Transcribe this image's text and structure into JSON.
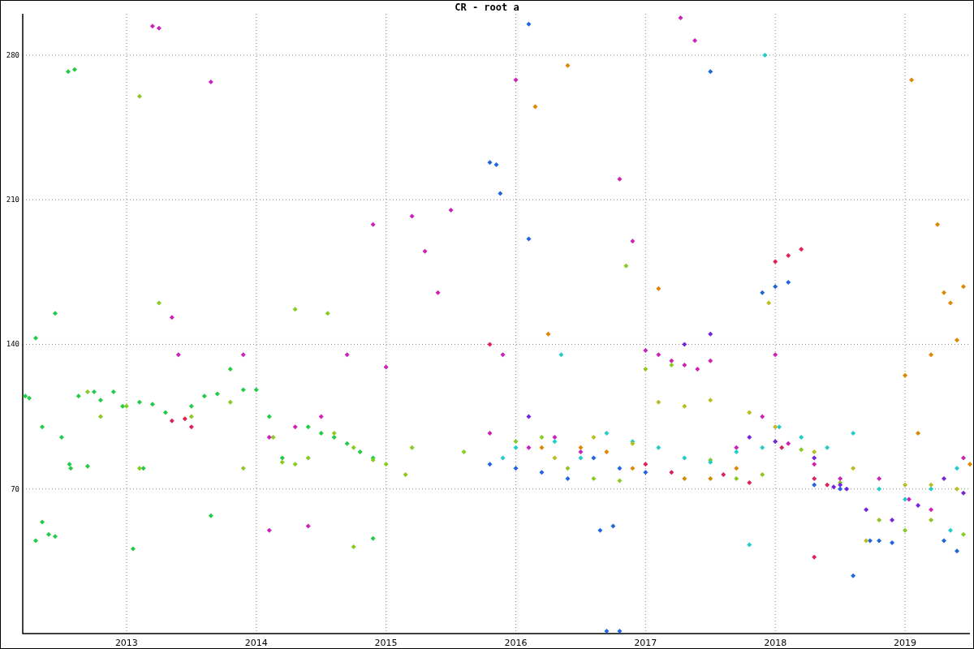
{
  "chart_data": {
    "type": "scatter",
    "title": "CR - root a",
    "grid": true,
    "xlim": [
      2012.2,
      2019.5
    ],
    "ylim": [
      0,
      300
    ],
    "xticks": [
      {
        "value": 2013,
        "label": "2013"
      },
      {
        "value": 2014,
        "label": "2014"
      },
      {
        "value": 2015,
        "label": "2015"
      },
      {
        "value": 2016,
        "label": "2016"
      },
      {
        "value": 2017,
        "label": "2017"
      },
      {
        "value": 2018,
        "label": "2018"
      },
      {
        "value": 2019,
        "label": "2019"
      }
    ],
    "yticks": [
      {
        "value": 70,
        "label": "70"
      },
      {
        "value": 140,
        "label": "140"
      },
      {
        "value": 210,
        "label": "210"
      },
      {
        "value": 280,
        "label": "280"
      }
    ],
    "series": [
      {
        "color": "#22cc44",
        "x": [
          2012.22,
          2012.25,
          2012.3,
          2012.35,
          2012.45,
          2012.5,
          2012.4,
          2012.45,
          2012.55,
          2012.6,
          2012.63,
          2012.75,
          2012.8,
          2012.9,
          2012.97,
          2013.13,
          2013.1,
          2013.2,
          2013.3,
          2013.5,
          2013.6,
          2013.65,
          2013.7,
          2013.8,
          2013.9,
          2014.0,
          2014.1,
          2014.2,
          2014.4,
          2014.5,
          2014.6,
          2014.7,
          2014.8,
          2014.9,
          2013.05,
          2012.56,
          2012.57,
          2012.7,
          2014.9,
          2012.3,
          2012.35
        ],
        "values": [
          115,
          114,
          143,
          100,
          155,
          95,
          48,
          47,
          272,
          273,
          115,
          117,
          113,
          117,
          110,
          80,
          112,
          111,
          107,
          110,
          115,
          57,
          116,
          128,
          118,
          118,
          105,
          85,
          100,
          97,
          95,
          92,
          88,
          85,
          41,
          82,
          80,
          81,
          46,
          45,
          54
        ]
      },
      {
        "color": "#88cc22",
        "x": [
          2012.7,
          2012.8,
          2013.0,
          2013.1,
          2013.25,
          2013.5,
          2013.8,
          2013.9,
          2014.13,
          2014.2,
          2014.3,
          2014.4,
          2014.6,
          2014.75,
          2014.9,
          2015.0,
          2015.15,
          2014.3,
          2014.55,
          2015.6,
          2016.0,
          2016.2,
          2016.4,
          2016.6,
          2016.8,
          2017.0,
          2017.2,
          2017.5,
          2017.7,
          2017.9,
          2018.2,
          2018.5,
          2018.8,
          2019.0,
          2019.2,
          2019.45,
          2016.85,
          2013.1,
          2014.75,
          2015.2
        ],
        "values": [
          117,
          105,
          110,
          260,
          160,
          105,
          112,
          80,
          95,
          83,
          82,
          85,
          97,
          90,
          84,
          82,
          77,
          157,
          155,
          88,
          93,
          95,
          80,
          75,
          74,
          128,
          130,
          84,
          75,
          77,
          89,
          73,
          55,
          50,
          55,
          48,
          178,
          80,
          42,
          90
        ]
      },
      {
        "color": "#cc22bb",
        "x": [
          2013.2,
          2013.25,
          2013.35,
          2013.4,
          2013.65,
          2013.9,
          2014.1,
          2014.3,
          2014.5,
          2014.7,
          2014.9,
          2015.0,
          2015.2,
          2015.3,
          2015.4,
          2015.5,
          2016.0,
          2016.1,
          2016.3,
          2016.5,
          2016.8,
          2016.9,
          2017.0,
          2017.1,
          2017.2,
          2017.3,
          2017.4,
          2017.5,
          2017.7,
          2017.9,
          2018.0,
          2018.1,
          2018.3,
          2018.5,
          2018.8,
          2019.03,
          2019.2,
          2019.45,
          2017.27,
          2017.38,
          2015.8,
          2015.9,
          2014.1,
          2014.4
        ],
        "values": [
          294,
          293,
          153,
          135,
          267,
          135,
          95,
          100,
          105,
          135,
          198,
          129,
          202,
          185,
          165,
          205,
          268,
          90,
          95,
          88,
          220,
          190,
          137,
          135,
          132,
          130,
          128,
          132,
          90,
          105,
          135,
          92,
          82,
          75,
          75,
          65,
          60,
          85,
          298,
          287,
          97,
          135,
          50,
          52
        ]
      },
      {
        "color": "#dd2255",
        "x": [
          2013.35,
          2013.45,
          2013.5,
          2015.8,
          2017.0,
          2017.2,
          2017.6,
          2017.8,
          2018.0,
          2018.1,
          2018.2,
          2018.3,
          2018.4,
          2018.05,
          2018.3
        ],
        "values": [
          103,
          104,
          100,
          140,
          82,
          78,
          77,
          73,
          180,
          183,
          186,
          75,
          72,
          90,
          37
        ]
      },
      {
        "color": "#2266dd",
        "x": [
          2015.8,
          2015.85,
          2015.88,
          2016.1,
          2016.1,
          2015.8,
          2016.0,
          2016.2,
          2016.4,
          2016.6,
          2016.8,
          2017.0,
          2016.7,
          2016.8,
          2017.5,
          2017.9,
          2018.0,
          2018.1,
          2018.3,
          2018.5,
          2018.6,
          2018.73,
          2018.8,
          2018.9,
          2019.3,
          2019.4,
          2016.65,
          2016.75
        ],
        "values": [
          228,
          227,
          213,
          191,
          295,
          82,
          80,
          78,
          75,
          85,
          80,
          78,
          0,
          0,
          272,
          165,
          168,
          170,
          72,
          70,
          28,
          45,
          45,
          44,
          45,
          40,
          50,
          52
        ]
      },
      {
        "color": "#22cccc",
        "x": [
          2015.9,
          2016.0,
          2016.3,
          2016.5,
          2016.7,
          2016.9,
          2017.1,
          2017.3,
          2017.5,
          2017.7,
          2017.9,
          2018.03,
          2018.2,
          2018.4,
          2018.6,
          2018.8,
          2019.0,
          2019.2,
          2019.4,
          2017.92,
          2017.8,
          2019.35,
          2016.35
        ],
        "values": [
          85,
          90,
          93,
          85,
          97,
          93,
          90,
          85,
          83,
          88,
          90,
          100,
          95,
          90,
          97,
          70,
          65,
          70,
          80,
          280,
          43,
          50,
          135
        ]
      },
      {
        "color": "#dd8800",
        "x": [
          2016.2,
          2016.4,
          2016.5,
          2016.7,
          2016.9,
          2017.1,
          2017.3,
          2017.5,
          2017.7,
          2019.0,
          2019.05,
          2019.1,
          2019.2,
          2019.25,
          2019.3,
          2019.35,
          2019.4,
          2019.45,
          2019.5,
          2016.15,
          2016.25
        ],
        "values": [
          90,
          275,
          90,
          88,
          80,
          167,
          75,
          75,
          80,
          125,
          268,
          97,
          135,
          198,
          165,
          160,
          142,
          168,
          82,
          255,
          145
        ]
      },
      {
        "color": "#7722dd",
        "x": [
          2017.3,
          2017.5,
          2017.8,
          2018.0,
          2018.3,
          2018.5,
          2018.7,
          2018.9,
          2019.1,
          2019.3,
          2019.45,
          2016.1,
          2018.45,
          2018.55
        ],
        "values": [
          140,
          145,
          95,
          93,
          85,
          72,
          60,
          55,
          62,
          75,
          68,
          105,
          71,
          70
        ]
      },
      {
        "color": "#bbbb22",
        "x": [
          2016.3,
          2016.6,
          2016.9,
          2017.1,
          2017.3,
          2017.5,
          2017.8,
          2018.0,
          2018.3,
          2018.6,
          2019.0,
          2019.2,
          2019.4,
          2018.7,
          2017.95
        ],
        "values": [
          85,
          95,
          92,
          112,
          110,
          113,
          107,
          100,
          88,
          80,
          72,
          72,
          70,
          45,
          160
        ]
      }
    ]
  }
}
